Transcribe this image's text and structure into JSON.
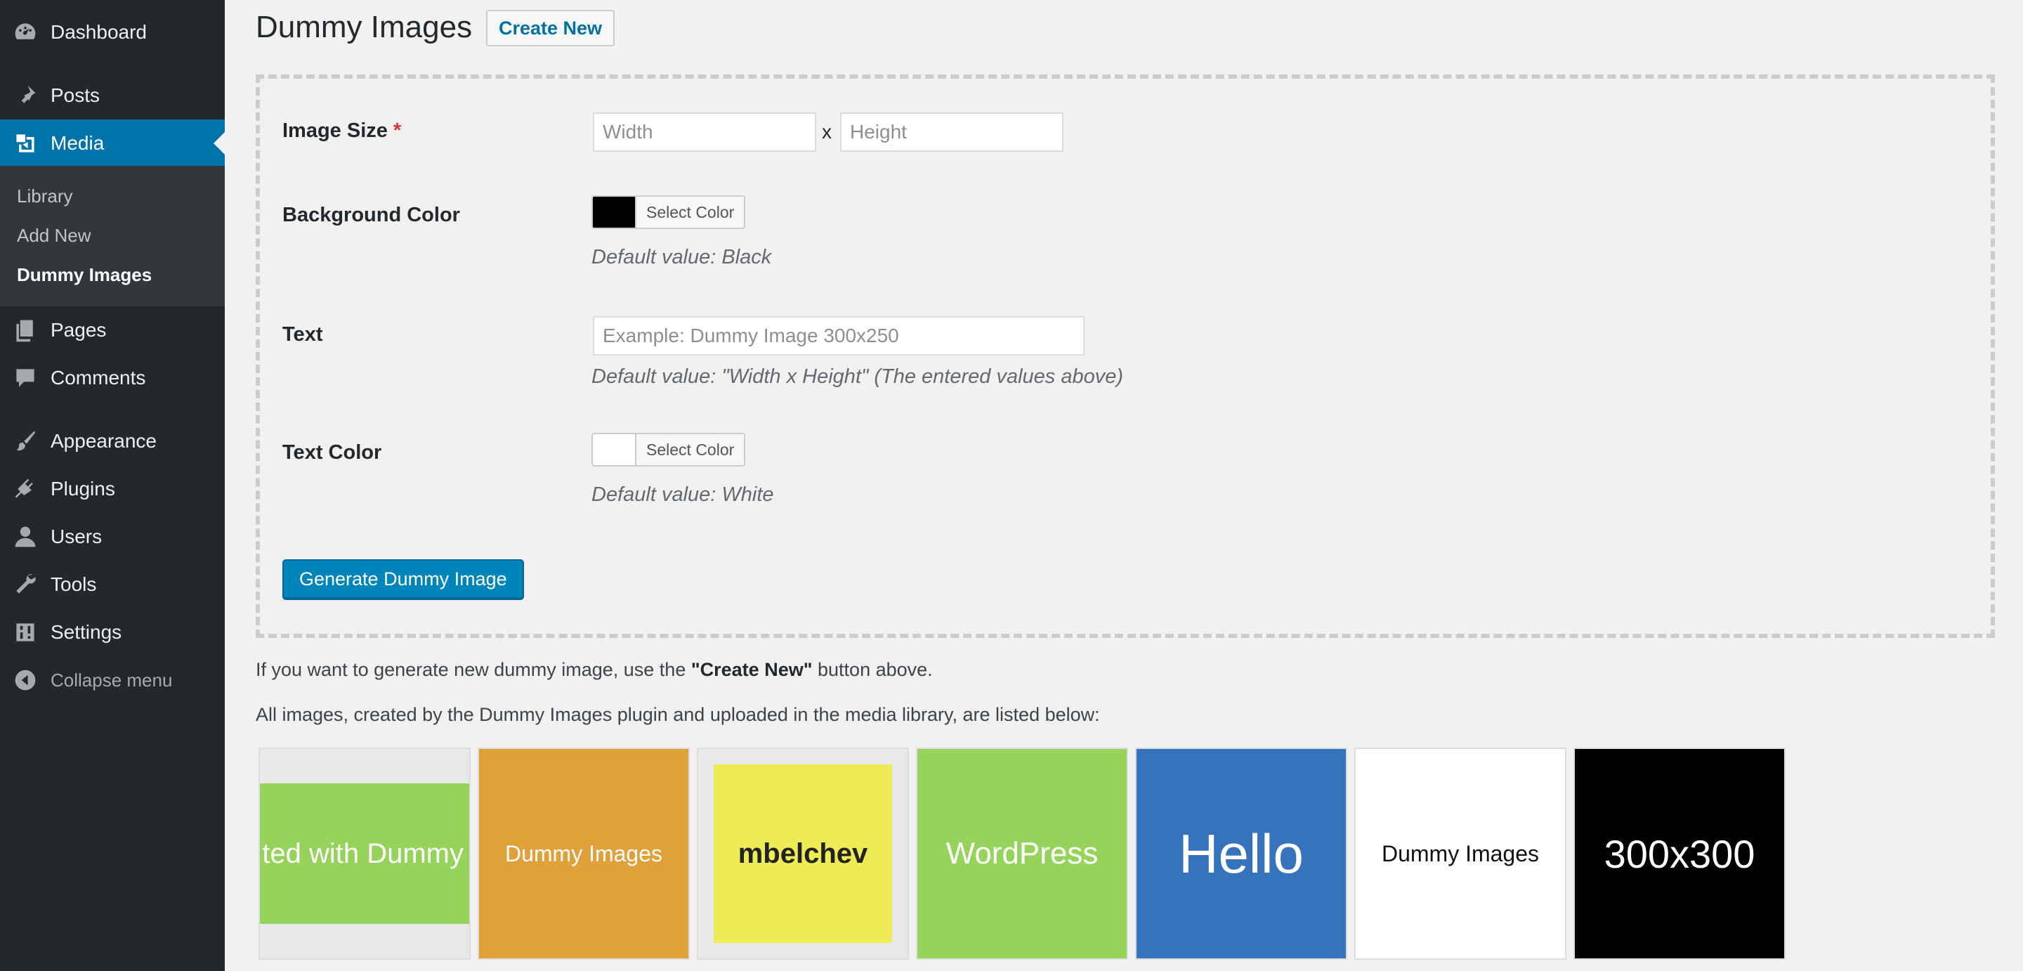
{
  "sidebar": {
    "items": [
      {
        "label": "Dashboard",
        "icon": "dashboard-icon"
      },
      {
        "label": "Posts",
        "icon": "pushpin-icon"
      },
      {
        "label": "Media",
        "icon": "media-icon"
      },
      {
        "label": "Pages",
        "icon": "pages-icon"
      },
      {
        "label": "Comments",
        "icon": "comment-icon"
      },
      {
        "label": "Appearance",
        "icon": "paintbrush-icon"
      },
      {
        "label": "Plugins",
        "icon": "plugin-icon"
      },
      {
        "label": "Users",
        "icon": "user-icon"
      },
      {
        "label": "Tools",
        "icon": "wrench-icon"
      },
      {
        "label": "Settings",
        "icon": "settings-icon"
      },
      {
        "label": "Collapse menu",
        "icon": "collapse-icon"
      }
    ],
    "submenu": [
      "Library",
      "Add New",
      "Dummy Images"
    ],
    "current_item": "Media",
    "current_subitem": "Dummy Images"
  },
  "page": {
    "title": "Dummy Images",
    "create_new_label": "Create New"
  },
  "form": {
    "image_size": {
      "label": "Image Size",
      "required_mark": "*",
      "width_placeholder": "Width",
      "height_placeholder": "Height",
      "separator": "x"
    },
    "background_color": {
      "label": "Background Color",
      "button_label": "Select Color",
      "swatch": "#000000",
      "default_text": "Default value: Black"
    },
    "text": {
      "label": "Text",
      "placeholder": "Example: Dummy Image 300x250",
      "default_text": "Default value: \"Width x Height\" (The entered values above)"
    },
    "text_color": {
      "label": "Text Color",
      "button_label": "Select Color",
      "swatch": "#ffffff",
      "default_text": "Default value: White"
    },
    "generate_label": "Generate Dummy Image"
  },
  "info": {
    "line1_before": "If you want to generate new dummy image, use the ",
    "line1_bold": "\"Create New\"",
    "line1_after": " button above.",
    "line2": "All images, created by the Dummy Images plugin and uploaded in the media library, are listed below:"
  },
  "gallery": [
    {
      "text": "ted with Dummy",
      "bg": "#95d35a",
      "color": "#ffffff",
      "frame": "#e8e8e8"
    },
    {
      "text": "Dummy Images",
      "bg": "#e0a03a",
      "color": "#ffffff",
      "frame": ""
    },
    {
      "text": "mbelchev",
      "bg": "#eeec55",
      "color": "#222222",
      "frame": "#e8e8e8"
    },
    {
      "text": "WordPress",
      "bg": "#95d35a",
      "color": "#ffffff",
      "frame": ""
    },
    {
      "text": "Hello",
      "bg": "#3673bd",
      "color": "#ffffff",
      "frame": ""
    },
    {
      "text": "Dummy Images",
      "bg": "#ffffff",
      "color": "#111111",
      "frame": ""
    },
    {
      "text": "300x300",
      "bg": "#000000",
      "color": "#ffffff",
      "frame": ""
    }
  ],
  "colors": {
    "sidebar_bg": "#23282d",
    "submenu_bg": "#32373c",
    "accent": "#0073aa",
    "primary_button": "#0085ba",
    "required": "#dc3232"
  }
}
